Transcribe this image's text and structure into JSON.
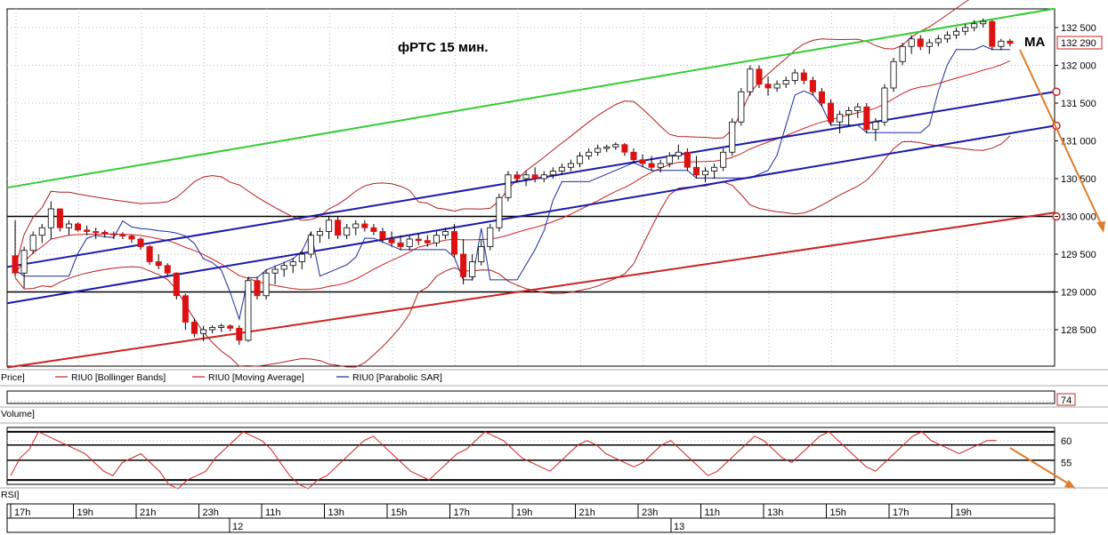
{
  "chart_data": {
    "type": "candlestick",
    "title": "фРТС   15 мин.",
    "annotation": "MA",
    "price_axis": {
      "ticks": [
        {
          "value": 132500,
          "label": "132 500"
        },
        {
          "value": 132000,
          "label": "132 000"
        },
        {
          "value": 131500,
          "label": "131 500"
        },
        {
          "value": 131000,
          "label": "131 000"
        },
        {
          "value": 130500,
          "label": "130 500"
        },
        {
          "value": 130000,
          "label": "130 000"
        },
        {
          "value": 129500,
          "label": "129 500"
        },
        {
          "value": 129000,
          "label": "129 000"
        },
        {
          "value": 128500,
          "label": "128 500"
        }
      ],
      "range": [
        128000,
        132700
      ],
      "current_price_label": "132 290",
      "current_price": 132290
    },
    "legend": {
      "price_label": "Price]",
      "items": [
        {
          "name": "RIU0 [Bollinger Bands]",
          "color": "#cc2222"
        },
        {
          "name": "RIU0 [Moving Average]",
          "color": "#cc2222"
        },
        {
          "name": "RIU0 [Parabolic SAR]",
          "color": "#1a2a9a"
        }
      ]
    },
    "volume_panel": {
      "label": "Volume]",
      "value_label": "74"
    },
    "rsi_panel": {
      "label": "RSI]",
      "ticks": [
        {
          "value": 60,
          "label": "60"
        },
        {
          "value": 55,
          "label": "55"
        }
      ],
      "range": [
        50,
        63
      ]
    },
    "time_axis": {
      "hour_labels": [
        "17h",
        "19h",
        "21h",
        "23h",
        "11h",
        "13h",
        "15h",
        "17h",
        "19h",
        "21h",
        "23h",
        "11h",
        "13h",
        "15h",
        "17h",
        "19h"
      ],
      "day_labels": [
        "12",
        "13"
      ]
    },
    "horizontal_levels": [
      130000,
      129000
    ],
    "trend_lines": [
      {
        "name": "green-channel-top",
        "color": "#33cc33",
        "from": [
          0,
          130380
        ],
        "to": [
          1,
          132750
        ]
      },
      {
        "name": "blue-channel-upper",
        "color": "#1a1aaa",
        "from": [
          0,
          129330
        ],
        "to": [
          1,
          131650
        ]
      },
      {
        "name": "blue-channel-lower",
        "color": "#1a1aaa",
        "from": [
          0,
          128850
        ],
        "to": [
          1,
          131200
        ]
      },
      {
        "name": "red-channel-bottom",
        "color": "#cc2222",
        "from": [
          0,
          128000
        ],
        "to": [
          1,
          130050
        ]
      }
    ],
    "candles": [
      [
        129480,
        129950,
        129200,
        129250
      ],
      [
        129250,
        129600,
        129050,
        129550
      ],
      [
        129550,
        129800,
        129500,
        129750
      ],
      [
        129750,
        129900,
        129650,
        129850
      ],
      [
        129850,
        130200,
        129700,
        130100
      ],
      [
        130100,
        130100,
        129800,
        129850
      ],
      [
        129850,
        129950,
        129750,
        129900
      ],
      [
        129900,
        129920,
        129800,
        129820
      ],
      [
        129820,
        129880,
        129750,
        129800
      ],
      [
        129800,
        129850,
        129700,
        129790
      ],
      [
        129790,
        129820,
        129720,
        129770
      ],
      [
        129770,
        129800,
        129700,
        129760
      ],
      [
        129760,
        129790,
        129700,
        129740
      ],
      [
        129740,
        129760,
        129650,
        129700
      ],
      [
        129700,
        129720,
        129560,
        129600
      ],
      [
        129600,
        129620,
        129360,
        129400
      ],
      [
        129400,
        129500,
        129300,
        129350
      ],
      [
        129350,
        129380,
        129200,
        129250
      ],
      [
        129250,
        129260,
        128900,
        128950
      ],
      [
        128950,
        128980,
        128500,
        128600
      ],
      [
        128600,
        128650,
        128400,
        128450
      ],
      [
        128450,
        128550,
        128350,
        128500
      ],
      [
        128500,
        128560,
        128450,
        128530
      ],
      [
        128530,
        128580,
        128470,
        128550
      ],
      [
        128550,
        128570,
        128480,
        128520
      ],
      [
        128520,
        128560,
        128300,
        128360
      ],
      [
        128360,
        129200,
        128340,
        129150
      ],
      [
        129150,
        129200,
        128900,
        128950
      ],
      [
        128950,
        129300,
        128900,
        129250
      ],
      [
        129250,
        129350,
        129100,
        129300
      ],
      [
        129300,
        129400,
        129200,
        129350
      ],
      [
        129350,
        129450,
        129250,
        129400
      ],
      [
        129400,
        129550,
        129300,
        129500
      ],
      [
        129500,
        129800,
        129450,
        129750
      ],
      [
        129750,
        129850,
        129650,
        129800
      ],
      [
        129800,
        130000,
        129700,
        129950
      ],
      [
        129950,
        130000,
        129700,
        129750
      ],
      [
        129750,
        129900,
        129700,
        129850
      ],
      [
        129850,
        129950,
        129750,
        129900
      ],
      [
        129900,
        129950,
        129800,
        129850
      ],
      [
        129850,
        129900,
        129750,
        129800
      ],
      [
        129800,
        129850,
        129650,
        129700
      ],
      [
        129700,
        129800,
        129600,
        129650
      ],
      [
        129650,
        129750,
        129550,
        129600
      ],
      [
        129600,
        129750,
        129550,
        129700
      ],
      [
        129700,
        129780,
        129620,
        129680
      ],
      [
        129680,
        129750,
        129600,
        129650
      ],
      [
        129650,
        129800,
        129600,
        129750
      ],
      [
        129750,
        129850,
        129700,
        129800
      ],
      [
        129800,
        129900,
        129450,
        129500
      ],
      [
        129500,
        129700,
        129100,
        129200
      ],
      [
        129200,
        129500,
        129150,
        129400
      ],
      [
        129400,
        129700,
        129350,
        129600
      ],
      [
        129600,
        129900,
        129550,
        129850
      ],
      [
        129850,
        130300,
        129800,
        130250
      ],
      [
        130250,
        130600,
        130200,
        130550
      ],
      [
        130550,
        130600,
        130450,
        130500
      ],
      [
        130500,
        130600,
        130400,
        130550
      ],
      [
        130550,
        130650,
        130450,
        130500
      ],
      [
        130500,
        130600,
        130450,
        130550
      ],
      [
        130550,
        130650,
        130500,
        130600
      ],
      [
        130600,
        130700,
        130550,
        130650
      ],
      [
        130650,
        130750,
        130600,
        130700
      ],
      [
        130700,
        130850,
        130650,
        130800
      ],
      [
        130800,
        130900,
        130750,
        130850
      ],
      [
        130850,
        130950,
        130800,
        130900
      ],
      [
        130900,
        130950,
        130850,
        130920
      ],
      [
        130920,
        130980,
        130880,
        130950
      ],
      [
        130950,
        130970,
        130800,
        130850
      ],
      [
        130850,
        130900,
        130700,
        130750
      ],
      [
        130750,
        130820,
        130650,
        130700
      ],
      [
        130700,
        130800,
        130600,
        130650
      ],
      [
        130650,
        130750,
        130580,
        130700
      ],
      [
        130700,
        130850,
        130650,
        130800
      ],
      [
        130800,
        130950,
        130750,
        130850
      ],
      [
        130850,
        130900,
        130600,
        130650
      ],
      [
        130650,
        130800,
        130500,
        130550
      ],
      [
        130550,
        130650,
        130450,
        130600
      ],
      [
        130600,
        130700,
        130500,
        130650
      ],
      [
        130650,
        130900,
        130600,
        130850
      ],
      [
        130850,
        131300,
        130800,
        131250
      ],
      [
        131250,
        131700,
        131200,
        131650
      ],
      [
        131650,
        132000,
        131600,
        131950
      ],
      [
        131950,
        132000,
        131700,
        131750
      ],
      [
        131750,
        131850,
        131600,
        131700
      ],
      [
        131700,
        131800,
        131650,
        131750
      ],
      [
        131750,
        131850,
        131700,
        131800
      ],
      [
        131800,
        131950,
        131750,
        131900
      ],
      [
        131900,
        131950,
        131750,
        131800
      ],
      [
        131800,
        131850,
        131600,
        131650
      ],
      [
        131650,
        131700,
        131450,
        131500
      ],
      [
        131500,
        131550,
        131200,
        131250
      ],
      [
        131250,
        131400,
        131100,
        131350
      ],
      [
        131350,
        131450,
        131200,
        131400
      ],
      [
        131400,
        131500,
        131300,
        131450
      ],
      [
        131450,
        131500,
        131100,
        131150
      ],
      [
        131150,
        131300,
        131000,
        131250
      ],
      [
        131250,
        131750,
        131200,
        131700
      ],
      [
        131700,
        132100,
        131650,
        132050
      ],
      [
        132050,
        132300,
        132000,
        132250
      ],
      [
        132250,
        132400,
        132150,
        132350
      ],
      [
        132350,
        132400,
        132200,
        132250
      ],
      [
        132250,
        132350,
        132150,
        132300
      ],
      [
        132300,
        132400,
        132250,
        132350
      ],
      [
        132350,
        132450,
        132300,
        132400
      ],
      [
        132400,
        132500,
        132350,
        132450
      ],
      [
        132450,
        132550,
        132400,
        132500
      ],
      [
        132500,
        132600,
        132450,
        132550
      ],
      [
        132550,
        132620,
        132500,
        132580
      ],
      [
        132580,
        132600,
        132200,
        132250
      ],
      [
        132250,
        132350,
        132200,
        132320
      ],
      [
        132320,
        132350,
        132250,
        132290
      ]
    ],
    "rsi_values": [
      52,
      56,
      58,
      62,
      61,
      60,
      59,
      58,
      57,
      55,
      53,
      52,
      55,
      56,
      57,
      55,
      53,
      50,
      49,
      51,
      52,
      53,
      56,
      58,
      60,
      62,
      61,
      60,
      58,
      55,
      52,
      50,
      49,
      51,
      52,
      54,
      56,
      58,
      60,
      61,
      59,
      57,
      55,
      53,
      52,
      51,
      53,
      55,
      57,
      58,
      60,
      62,
      61,
      60,
      58,
      56,
      55,
      54,
      53,
      55,
      57,
      59,
      60,
      59,
      57,
      56,
      55,
      54,
      55,
      57,
      59,
      60,
      58,
      56,
      54,
      52,
      53,
      55,
      57,
      59,
      61,
      60,
      58,
      56,
      55,
      57,
      59,
      61,
      62,
      60,
      58,
      56,
      54,
      53,
      55,
      57,
      59,
      61,
      62,
      60,
      59,
      58,
      57,
      58,
      59,
      60,
      60
    ]
  }
}
